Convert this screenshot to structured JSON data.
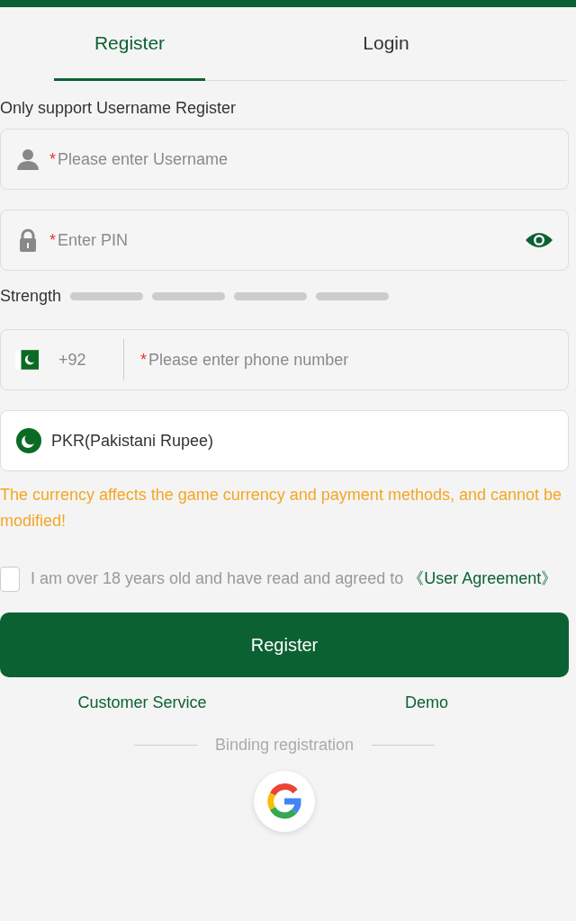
{
  "tabs": [
    {
      "label": "Register",
      "selected": true
    },
    {
      "label": "Login",
      "selected": false
    }
  ],
  "notice": "Only support Username Register",
  "username": {
    "required": "*",
    "placeholder": "Please enter Username"
  },
  "pin": {
    "required": "*",
    "placeholder": "Enter PIN"
  },
  "strength": {
    "label": "Strength"
  },
  "phone": {
    "code": "+92",
    "required": "*",
    "placeholder": "Please enter phone number"
  },
  "currency": {
    "value": "PKR(Pakistani Rupee)"
  },
  "warning": "The currency affects the game currency and payment methods, and cannot be modified!",
  "agreement": {
    "checked": false,
    "text": "I am over 18 years old and have read and agreed to",
    "link": "《User Agreement》"
  },
  "submit": "Register",
  "links": [
    "Customer Service",
    "Demo"
  ],
  "binding": "Binding registration"
}
